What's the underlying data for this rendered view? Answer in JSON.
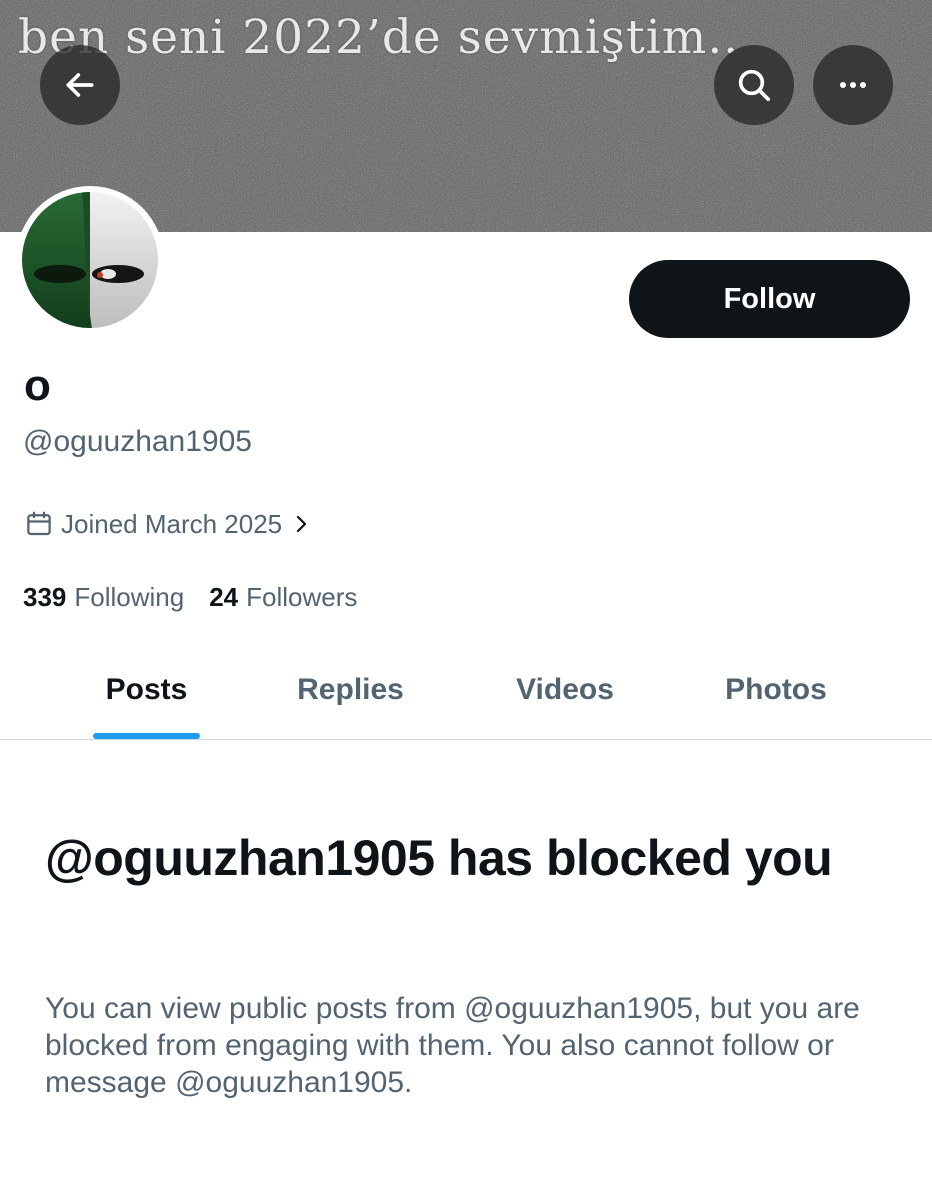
{
  "banner": {
    "text": "ben seni 2022’de sevmiştim..",
    "background_color": "#5e5e5e"
  },
  "header": {
    "back_icon": "arrow-left-icon",
    "search_icon": "search-icon",
    "more_icon": "more-horizontal-icon"
  },
  "avatar": {
    "colors": [
      "#1e5a2a",
      "#e6e6e6"
    ]
  },
  "profile": {
    "display_name": "o",
    "handle": "@oguuzhan1905",
    "joined": "Joined March 2025",
    "following_count": "339",
    "following_label": "Following",
    "followers_count": "24",
    "followers_label": "Followers"
  },
  "actions": {
    "follow_label": "Follow"
  },
  "tabs": [
    {
      "label": "Posts",
      "active": true
    },
    {
      "label": "Replies",
      "active": false
    },
    {
      "label": "Videos",
      "active": false
    },
    {
      "label": "Photos",
      "active": false
    }
  ],
  "blocked": {
    "title": "@oguuzhan1905 has blocked you",
    "body": "You can view public posts from @oguuzhan1905, but you are blocked from engaging with them. You also cannot follow or message @oguuzhan1905."
  },
  "colors": {
    "text_primary": "#0f1419",
    "text_secondary": "#536471",
    "accent": "#1d9bf0",
    "divider": "#cfd9de",
    "button_bg": "#0f1419"
  }
}
